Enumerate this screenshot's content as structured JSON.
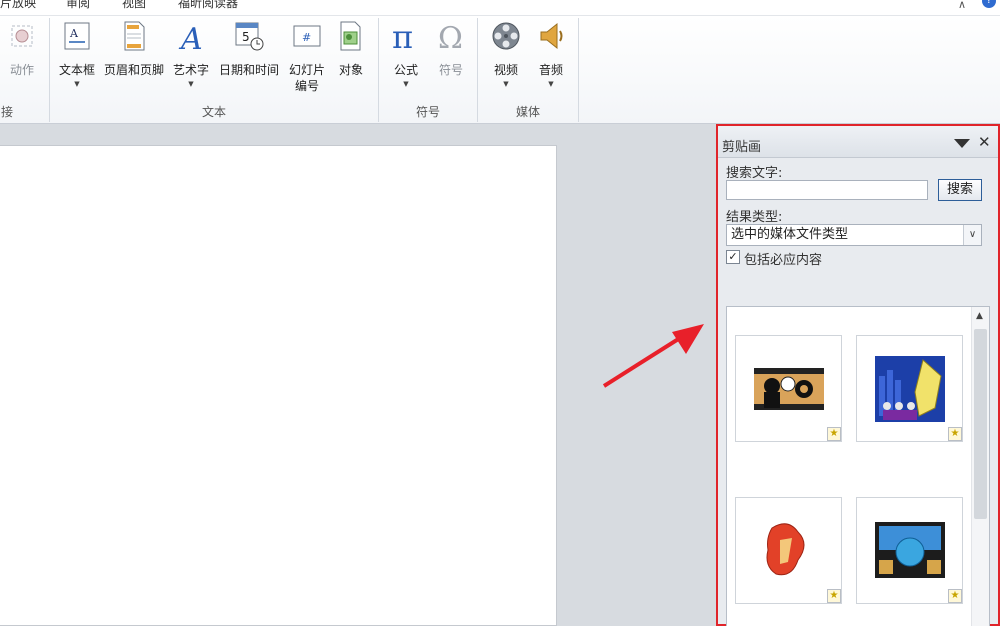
{
  "tabs": [
    "片放映",
    "审阅",
    "视图",
    "福昕阅读器"
  ],
  "ribbon": {
    "groups": [
      {
        "label": "接"
      },
      {
        "label": "文本"
      },
      {
        "label": "符号"
      },
      {
        "label": "媒体"
      }
    ],
    "buttons": {
      "action": "动作",
      "textbox": "文本框",
      "header_footer": "页眉和页脚",
      "wordart": "艺术字",
      "datetime": "日期和时间",
      "slide_number_1": "幻灯片",
      "slide_number_2": "编号",
      "object": "对象",
      "equation": "公式",
      "symbol": "符号",
      "video": "视频",
      "audio": "音频"
    }
  },
  "pane": {
    "title": "剪贴画",
    "search_label": "搜索文字:",
    "search_value": "",
    "search_button": "搜索",
    "result_type_label": "结果类型:",
    "result_type_value": "选中的媒体文件类型",
    "include_office": "包括必应内容",
    "include_office_checked": true
  },
  "colors": {
    "highlight_border": "#e0242a",
    "arrow": "#e8202a",
    "accent": "#2d5e99"
  }
}
